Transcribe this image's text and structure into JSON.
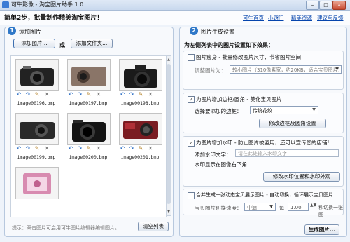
{
  "window": {
    "title": "可牛影像 - 淘宝图片助手 1.0",
    "buttons": {
      "minimize": "–",
      "maximize": "□",
      "close": "×"
    }
  },
  "header": {
    "slogan": "简单2步，批量制作精美淘宝图片！",
    "links": [
      "可牛首页",
      "小窍门",
      "精美资源",
      "建议与反馈"
    ]
  },
  "left": {
    "step": "1",
    "label": "添加图片",
    "add_image_button": "添加图片...",
    "or_text": "或",
    "add_folder_button": "添加文件夹...",
    "images": [
      {
        "name": "image00196.bmp",
        "color": "#222222"
      },
      {
        "name": "image00197.bmp",
        "color": "#8a7568"
      },
      {
        "name": "image00198.bmp",
        "color": "#1a1a1a"
      },
      {
        "name": "image00199.bmp",
        "color": "#2a2a2a"
      },
      {
        "name": "image00200.bmp",
        "color": "#141414"
      },
      {
        "name": "image00201.bmp",
        "color": "#7a1c22"
      },
      {
        "name": "",
        "color": "#d88bb0"
      }
    ],
    "hint": "提示：双击图片可启用可牛图片编辑器编辑图片。",
    "clear_button": "清空列表"
  },
  "right": {
    "step": "2",
    "label": "图片生成设置",
    "heading": "为左侧列表中的图片设置如下效果：",
    "resize": {
      "checked": false,
      "label": "图片瘦身 - 批量修改图片尺寸，节省图片空间!",
      "size_label": "调整图片为：",
      "size_value": "较小图片（310像素宽，约20KB，适合宝贝图片）"
    },
    "border": {
      "checked": true,
      "label": "为图片增加边框/圆角 - 美化宝贝图片",
      "select_label": "选择要添加的边框：",
      "select_value": "传统花纹",
      "button": "修改边框及圆角设置"
    },
    "watermark": {
      "checked": true,
      "label": "为图片增加水印 - 防止图片被盗用，还可以宣传您的店铺!",
      "text_label": "添加水印文字：",
      "text_placeholder": "请在此处输入水印文字",
      "position_text": "水印显示在图像右下角",
      "button": "修改水印位置和水印外观"
    },
    "flash": {
      "checked": false,
      "label": "合并生成一张动态宝贝展示图片 - 自动切换，循环展示宝贝图片",
      "speed_label": "宝贝图片切换速度：",
      "speed_value": "中速",
      "every_label": "每",
      "seconds_value": "1.00",
      "seconds_label": "秒切换一张图"
    },
    "generate_button": "生成图片..."
  }
}
